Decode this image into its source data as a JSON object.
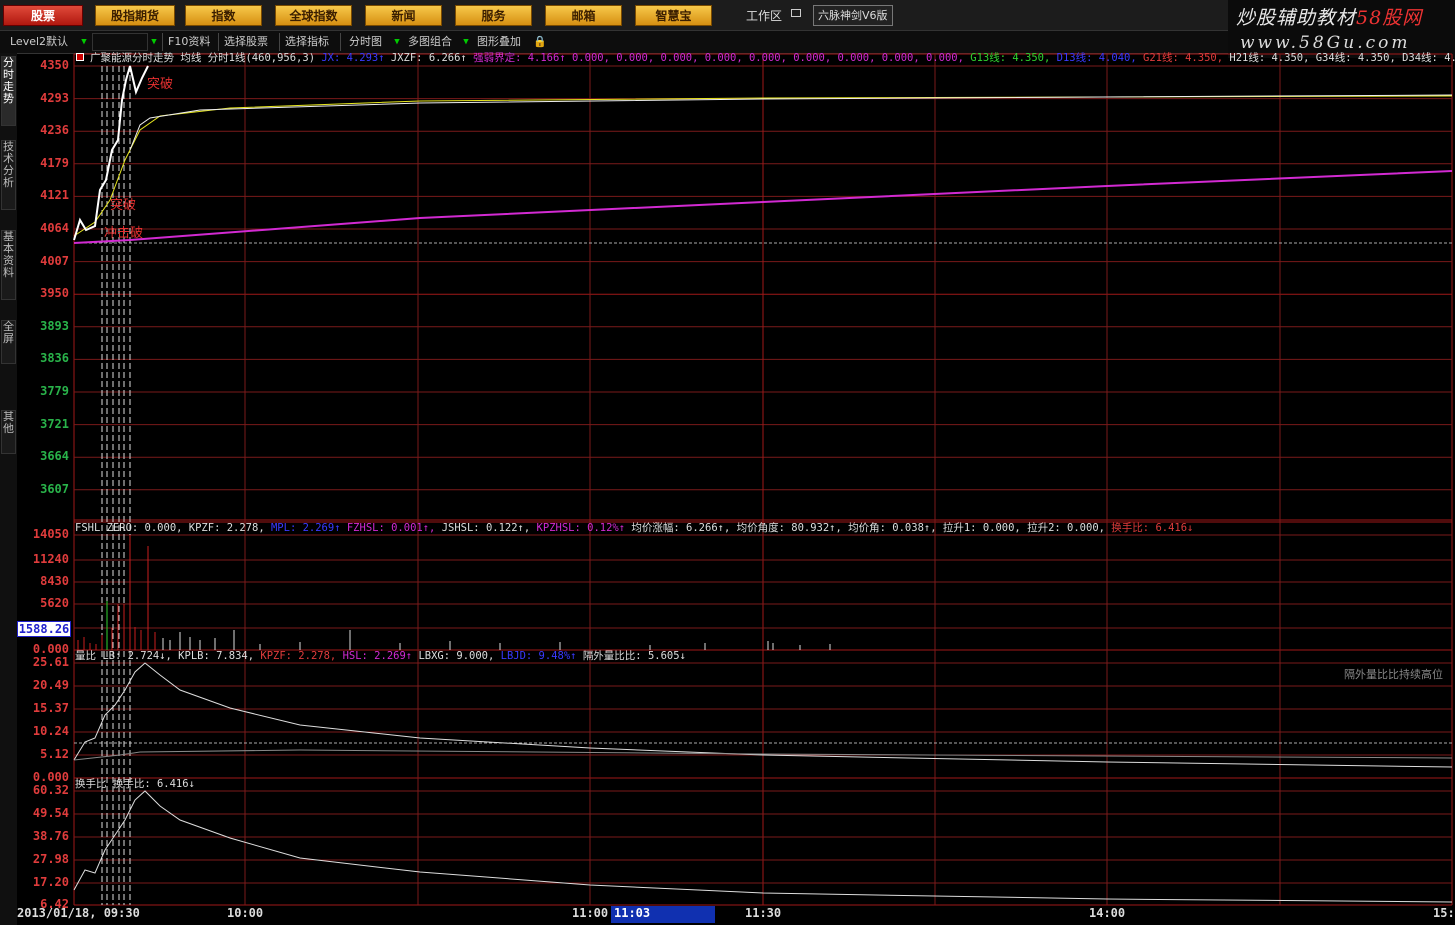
{
  "menu": {
    "items": [
      "股票",
      "股指期货",
      "指数",
      "全球指数",
      "新闻",
      "服务",
      "邮箱",
      "智慧宝"
    ],
    "active_index": 0,
    "workzone": "工作区",
    "version": "六脉神剑V6版"
  },
  "brand": {
    "name_main": "炒股辅助教材",
    "name_accent": "58股网",
    "url": "www.58Gu.com"
  },
  "toolbar": {
    "level": "Level2默认",
    "f10": "F10资料",
    "select_stock": "选择股票",
    "select_indicator": "选择指标",
    "timeshare": "分时图",
    "multi": "多图组合",
    "overlay": "图形叠加"
  },
  "side_tabs": [
    "分时走势",
    "技术分析",
    "基本资料",
    "全屏",
    "其他"
  ],
  "main_chart": {
    "header": {
      "stock": "广聚能源分时走势",
      "avg_label": "均线",
      "ind_name": "分时1线(460,956,3)",
      "jx": "JX: 4.293↑",
      "jxzf": "JXZF: 6.266↑",
      "mid": "强弱界定: 4.166↑",
      "zeros": "0.000, 0.000, 0.000, 0.000, 0.000, 0.000, 0.000, 0.000, 0.000,",
      "g13": "G13线: 4.350,",
      "d13": "D13线: 4.040,",
      "g21": "G21线: 4.350,",
      "tail": "H21线: 4.350, G34线: 4.350, D34线: 4.350"
    },
    "y_labels": [
      "4350",
      "4293",
      "4236",
      "4179",
      "4121",
      "4064",
      "4007",
      "3950",
      "3893",
      "3836",
      "3779",
      "3721",
      "3664",
      "3607"
    ],
    "y_colors": [
      "red",
      "red",
      "red",
      "red",
      "red",
      "red",
      "red",
      "red",
      "green",
      "green",
      "green",
      "green",
      "green",
      "green"
    ],
    "annotations": [
      "突破",
      "突破",
      "冲击破"
    ]
  },
  "volume_panel": {
    "header": [
      "FSHL ZERO: 0.000, KPZF: 2.278,",
      "MPL: 2.269↑",
      "FZHSL: 0.001↑,",
      "JSHSL: 0.122↑,",
      "KPZHSL: 0.12%↑",
      "均价涨幅: 6.266↑, 均价角度: 80.932↑, 均价角: 0.038↑, 拉升1: 0.000, 拉升2: 0.000,",
      "换手比: 6.416↓"
    ],
    "y_labels": [
      "14050",
      "11240",
      "8430",
      "5620",
      "1588.26",
      "0.000"
    ],
    "current_value": "1588.26"
  },
  "ratio_panel": {
    "header": [
      "量比 LB: 2.724↓, KPLB: 7.834,",
      "KPZF: 2.278,",
      "HSL: 2.269↑",
      "LBXG: 9.000,",
      "LBJD: 9.48%↑",
      "隔外量比比: 5.605↓"
    ],
    "y_labels": [
      "25.61",
      "20.49",
      "15.37",
      "10.24",
      "5.12",
      "0.000"
    ],
    "note": "隔外量比比持续高位"
  },
  "turnover_panel": {
    "header": [
      "换手比",
      "换手比: 6.416↓"
    ],
    "y_labels": [
      "60.32",
      "49.54",
      "38.76",
      "27.98",
      "17.20",
      "6.42"
    ]
  },
  "x_axis": {
    "date_time": "2013/01/18, 09:30",
    "ticks": [
      "10:00",
      "11:00",
      "11:30",
      "14:00",
      "15:"
    ],
    "cursor_time": "11:03"
  },
  "colors": {
    "price": "#ffffff",
    "avg": "#e6e61e",
    "indicator": "#d22ad2",
    "grid": "#7a1a1a",
    "grid_major": "#a01818",
    "volume": "#c81e1e"
  }
}
